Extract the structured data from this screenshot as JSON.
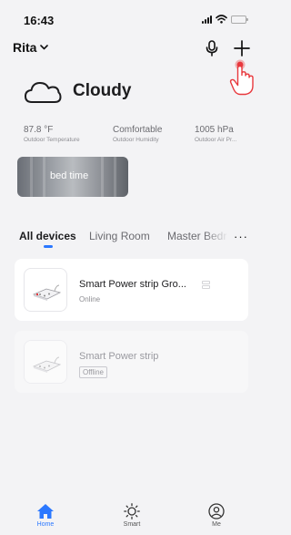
{
  "status_bar": {
    "time": "16:43"
  },
  "header": {
    "home_name": "Rita",
    "mic_icon": "microphone-icon",
    "add_icon": "plus-icon"
  },
  "weather": {
    "condition": "Cloudy",
    "icon": "cloud-icon",
    "metrics": [
      {
        "value": "87.8 °F",
        "label": "Outdoor Temperature"
      },
      {
        "value": "Comfortable",
        "label": "Outdoor Humidity"
      },
      {
        "value": "1005 hPa",
        "label": "Outdoor Air Pr..."
      }
    ]
  },
  "scene": {
    "label": "bed time"
  },
  "tabs": {
    "items": [
      {
        "label": "All devices"
      },
      {
        "label": "Living Room"
      },
      {
        "label": "Master Bedr"
      }
    ],
    "more": "···"
  },
  "devices": [
    {
      "name": "Smart Power strip Gro...",
      "status": "Online",
      "icon": "power-strip-icon",
      "badge_icon": "group-icon"
    },
    {
      "name": "Smart Power strip",
      "status": "Offline",
      "icon": "power-strip-icon"
    }
  ],
  "tabbar": {
    "items": [
      {
        "label": "Home",
        "icon": "home-icon"
      },
      {
        "label": "Smart",
        "icon": "smart-sun-icon"
      },
      {
        "label": "Me",
        "icon": "profile-icon"
      }
    ],
    "active_color": "#2b78ff"
  }
}
